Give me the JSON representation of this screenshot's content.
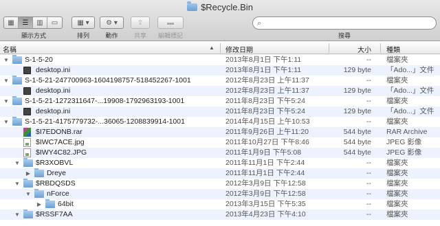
{
  "window": {
    "title": "$Recycle.Bin"
  },
  "toolbar": {
    "view_label": "顯示方式",
    "arrange_label": "排列",
    "action_label": "動作",
    "share_label": "共享",
    "tags_label": "編輯標記",
    "search_label": "搜尋",
    "search_value": "",
    "view_icons": [
      "icon-view-icon",
      "list-view-icon",
      "column-view-icon",
      "coverflow-view-icon"
    ],
    "view_glyphs": [
      "▦",
      "☰",
      "▥",
      "▭"
    ],
    "arrange_glyph": "▦ ▾",
    "action_glyph": "⚙ ▾",
    "share_glyph": "⇪",
    "tags_glyph": "▬",
    "search_glyph": "⌕"
  },
  "columns": {
    "name": "名稱",
    "date": "修改日期",
    "size": "大小",
    "kind": "種類",
    "sort_glyph": "▲"
  },
  "rows": [
    {
      "level": 0,
      "disc": "▼",
      "icon": "folder",
      "name": "S-1-5-20",
      "date": "2013年8月1日 下午1:11",
      "size": "--",
      "kind": "檔案夾"
    },
    {
      "level": 1,
      "disc": "",
      "icon": "doc",
      "name": "desktop.ini",
      "date": "2013年8月1日 下午1:11",
      "size": "129 byte",
      "kind": "「Ado...」文件"
    },
    {
      "level": 0,
      "disc": "▼",
      "icon": "folder",
      "name": "S-1-5-21-247700963-1604198757-518452267-1001",
      "date": "2012年8月23日 上午11:37",
      "size": "--",
      "kind": "檔案夾"
    },
    {
      "level": 1,
      "disc": "",
      "icon": "doc",
      "name": "desktop.ini",
      "date": "2012年8月23日 上午11:37",
      "size": "129 byte",
      "kind": "「Ado...」文件"
    },
    {
      "level": 0,
      "disc": "▼",
      "icon": "folder",
      "name": "S-1-5-21-1272311647-...19908-1792963193-1001",
      "date": "2011年8月23日 下午5:24",
      "size": "--",
      "kind": "檔案夾"
    },
    {
      "level": 1,
      "disc": "",
      "icon": "doc",
      "name": "desktop.ini",
      "date": "2011年8月23日 下午5:24",
      "size": "129 byte",
      "kind": "「Ado...」文件"
    },
    {
      "level": 0,
      "disc": "▼",
      "icon": "folder",
      "name": "S-1-5-21-4175779732-...36065-1208839914-1001",
      "date": "2014年4月15日 上午10:53",
      "size": "--",
      "kind": "檔案夾"
    },
    {
      "level": 1,
      "disc": "",
      "icon": "rar",
      "name": "$I7EDONB.rar",
      "date": "2011年9月26日 上午11:20",
      "size": "544 byte",
      "kind": "RAR Archive"
    },
    {
      "level": 1,
      "disc": "",
      "icon": "jpg",
      "name": "$IWC7ACE.jpg",
      "date": "2011年10月27日 下午8:46",
      "size": "544 byte",
      "kind": "JPEG 影像"
    },
    {
      "level": 1,
      "disc": "",
      "icon": "jpg",
      "name": "$IWY4C82.JPG",
      "date": "2011年1月9日 下午5:08",
      "size": "544 byte",
      "kind": "JPEG 影像"
    },
    {
      "level": 1,
      "disc": "▼",
      "icon": "folder",
      "name": "$R3XOBVL",
      "date": "2011年11月1日 下午2:44",
      "size": "--",
      "kind": "檔案夾"
    },
    {
      "level": 2,
      "disc": "▶",
      "icon": "folder",
      "name": "Dreye",
      "date": "2011年11月1日 下午2:44",
      "size": "--",
      "kind": "檔案夾"
    },
    {
      "level": 1,
      "disc": "▼",
      "icon": "folder",
      "name": "$RBDQSDS",
      "date": "2012年3月9日 下午12:58",
      "size": "--",
      "kind": "檔案夾"
    },
    {
      "level": 2,
      "disc": "▼",
      "icon": "folder",
      "name": "nForce",
      "date": "2012年3月9日 下午12:58",
      "size": "--",
      "kind": "檔案夾"
    },
    {
      "level": 3,
      "disc": "▶",
      "icon": "folder",
      "name": "64bit",
      "date": "2013年3月15日 下午5:35",
      "size": "--",
      "kind": "檔案夾"
    },
    {
      "level": 1,
      "disc": "▼",
      "icon": "folder",
      "name": "$RSSF7AA",
      "date": "2013年4月23日 下午4:10",
      "size": "--",
      "kind": "檔案夾"
    }
  ]
}
